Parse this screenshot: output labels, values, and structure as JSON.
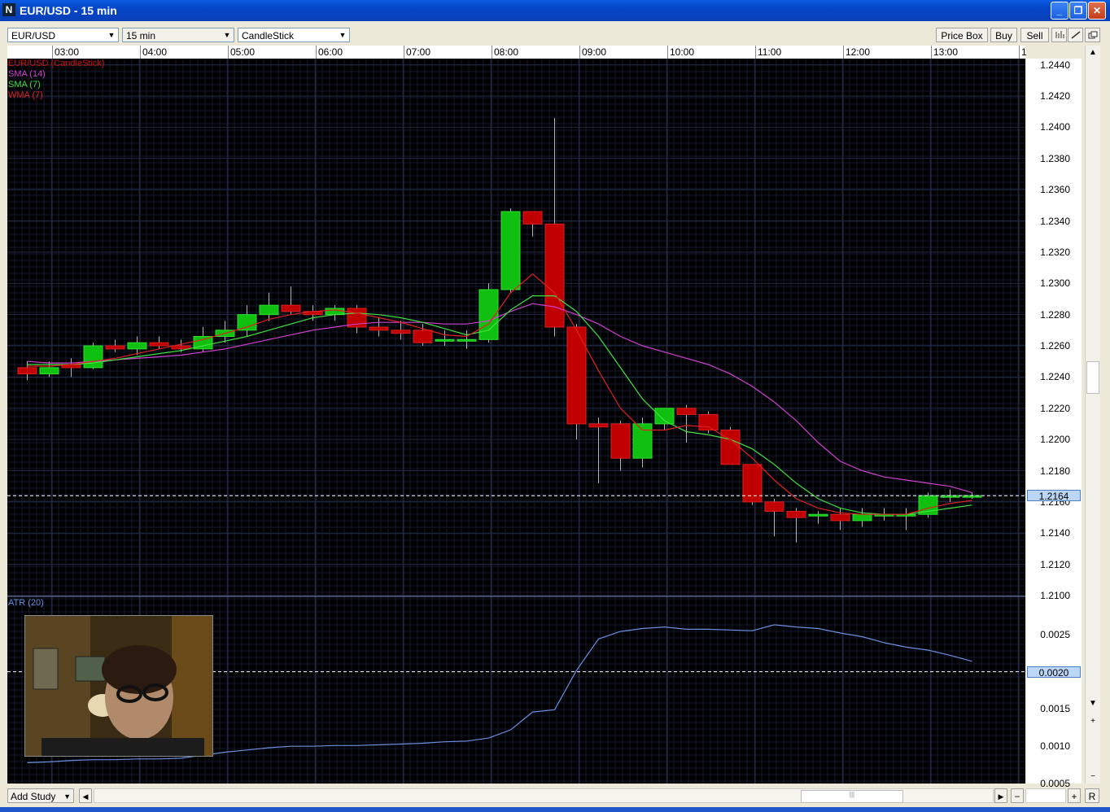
{
  "window": {
    "title": "EUR/USD - 15 min",
    "minimize": "_",
    "restore": "❐",
    "close": "✕"
  },
  "toolbar": {
    "symbol": "EUR/USD",
    "interval": "15 min",
    "chart_style": "CandleStick",
    "price_box_label": "Price Box",
    "buy_label": "Buy",
    "sell_label": "Sell",
    "draw_icon_1": "bar-chart-icon",
    "draw_icon_2": "line-draw-icon",
    "detach_icon": "detach-window-icon"
  },
  "legend": [
    {
      "label": "EUR/USD (CandleStick)",
      "color": "#cc1010"
    },
    {
      "label": "SMA (14)",
      "color": "#d040d0"
    },
    {
      "label": "SMA (7)",
      "color": "#40e040"
    },
    {
      "label": "WMA (7)",
      "color": "#e02020"
    }
  ],
  "atr_label": "ATR (20)",
  "current_price_label": "1.2164",
  "atr_current_label": "0.0020",
  "bottom": {
    "add_study": "Add Study",
    "zoom_out": "−",
    "zoom_in": "+",
    "reset": "R",
    "thumb_grip": "|||"
  },
  "chart_data": [
    {
      "type": "candlestick",
      "symbol": "EUR/USD",
      "time_ticks": [
        "03:00",
        "04:00",
        "05:00",
        "06:00",
        "07:00",
        "08:00",
        "09:00",
        "10:00",
        "11:00",
        "12:00",
        "13:00",
        "1"
      ],
      "y_ticks": [
        "1.2440",
        "1.2420",
        "1.2400",
        "1.2380",
        "1.2360",
        "1.2340",
        "1.2320",
        "1.2300",
        "1.2280",
        "1.2260",
        "1.2240",
        "1.2220",
        "1.2200",
        "1.2180",
        "1.2160",
        "1.2140",
        "1.2120",
        "1.2100"
      ],
      "ylim": [
        1.21,
        1.2444
      ],
      "candles": [
        {
          "o": 1.2246,
          "h": 1.225,
          "l": 1.2238,
          "c": 1.2242
        },
        {
          "o": 1.2242,
          "h": 1.225,
          "l": 1.224,
          "c": 1.2246
        },
        {
          "o": 1.2248,
          "h": 1.2252,
          "l": 1.224,
          "c": 1.2246
        },
        {
          "o": 1.2246,
          "h": 1.2262,
          "l": 1.2245,
          "c": 1.226
        },
        {
          "o": 1.226,
          "h": 1.2264,
          "l": 1.2256,
          "c": 1.2258
        },
        {
          "o": 1.2258,
          "h": 1.2266,
          "l": 1.2254,
          "c": 1.2262
        },
        {
          "o": 1.2262,
          "h": 1.2266,
          "l": 1.2258,
          "c": 1.226
        },
        {
          "o": 1.226,
          "h": 1.2264,
          "l": 1.2256,
          "c": 1.2258
        },
        {
          "o": 1.2258,
          "h": 1.2272,
          "l": 1.2256,
          "c": 1.2266
        },
        {
          "o": 1.2266,
          "h": 1.2276,
          "l": 1.2262,
          "c": 1.227
        },
        {
          "o": 1.227,
          "h": 1.2286,
          "l": 1.2266,
          "c": 1.228
        },
        {
          "o": 1.228,
          "h": 1.2294,
          "l": 1.2276,
          "c": 1.2286
        },
        {
          "o": 1.2286,
          "h": 1.2298,
          "l": 1.228,
          "c": 1.2282
        },
        {
          "o": 1.2282,
          "h": 1.2286,
          "l": 1.2276,
          "c": 1.228
        },
        {
          "o": 1.228,
          "h": 1.2286,
          "l": 1.2276,
          "c": 1.2284
        },
        {
          "o": 1.2284,
          "h": 1.2286,
          "l": 1.2268,
          "c": 1.2272
        },
        {
          "o": 1.2272,
          "h": 1.2278,
          "l": 1.2266,
          "c": 1.227
        },
        {
          "o": 1.227,
          "h": 1.2276,
          "l": 1.2264,
          "c": 1.2268
        },
        {
          "o": 1.227,
          "h": 1.2274,
          "l": 1.226,
          "c": 1.2262
        },
        {
          "o": 1.2263,
          "h": 1.227,
          "l": 1.226,
          "c": 1.2264
        },
        {
          "o": 1.2264,
          "h": 1.227,
          "l": 1.2258,
          "c": 1.2264
        },
        {
          "o": 1.2264,
          "h": 1.23,
          "l": 1.2262,
          "c": 1.2296
        },
        {
          "o": 1.2296,
          "h": 1.2348,
          "l": 1.2294,
          "c": 1.2346
        },
        {
          "o": 1.2346,
          "h": 1.2346,
          "l": 1.233,
          "c": 1.2338
        },
        {
          "o": 1.2338,
          "h": 1.2406,
          "l": 1.2266,
          "c": 1.2272
        },
        {
          "o": 1.2272,
          "h": 1.2274,
          "l": 1.22,
          "c": 1.221
        },
        {
          "o": 1.221,
          "h": 1.2214,
          "l": 1.2172,
          "c": 1.2208
        },
        {
          "o": 1.221,
          "h": 1.2212,
          "l": 1.218,
          "c": 1.2188
        },
        {
          "o": 1.2188,
          "h": 1.2214,
          "l": 1.2182,
          "c": 1.221
        },
        {
          "o": 1.221,
          "h": 1.222,
          "l": 1.2206,
          "c": 1.222
        },
        {
          "o": 1.222,
          "h": 1.2222,
          "l": 1.2198,
          "c": 1.2216
        },
        {
          "o": 1.2216,
          "h": 1.2218,
          "l": 1.2204,
          "c": 1.2206
        },
        {
          "o": 1.2206,
          "h": 1.2208,
          "l": 1.2184,
          "c": 1.2184
        },
        {
          "o": 1.2184,
          "h": 1.2184,
          "l": 1.2158,
          "c": 1.216
        },
        {
          "o": 1.216,
          "h": 1.2162,
          "l": 1.2138,
          "c": 1.2154
        },
        {
          "o": 1.2154,
          "h": 1.2156,
          "l": 1.2134,
          "c": 1.215
        },
        {
          "o": 1.2152,
          "h": 1.2154,
          "l": 1.2146,
          "c": 1.2152
        },
        {
          "o": 1.2152,
          "h": 1.2156,
          "l": 1.2142,
          "c": 1.2148
        },
        {
          "o": 1.2148,
          "h": 1.2156,
          "l": 1.2144,
          "c": 1.2152
        },
        {
          "o": 1.2152,
          "h": 1.2156,
          "l": 1.2148,
          "c": 1.2152
        },
        {
          "o": 1.2152,
          "h": 1.2156,
          "l": 1.2142,
          "c": 1.2152
        },
        {
          "o": 1.2152,
          "h": 1.2166,
          "l": 1.215,
          "c": 1.2164
        },
        {
          "o": 1.2164,
          "h": 1.2168,
          "l": 1.216,
          "c": 1.2164
        },
        {
          "o": 1.2164,
          "h": 1.2166,
          "l": 1.2162,
          "c": 1.2164
        }
      ],
      "sma14": [
        1.225,
        1.2249,
        1.2249,
        1.225,
        1.2251,
        1.2252,
        1.2253,
        1.2254,
        1.2256,
        1.2258,
        1.2261,
        1.2264,
        1.2267,
        1.227,
        1.2272,
        1.2274,
        1.2275,
        1.2275,
        1.2275,
        1.2274,
        1.2274,
        1.2276,
        1.2282,
        1.2287,
        1.2285,
        1.228,
        1.2274,
        1.2266,
        1.226,
        1.2256,
        1.2252,
        1.2248,
        1.2242,
        1.2234,
        1.2224,
        1.2212,
        1.2198,
        1.2186,
        1.218,
        1.2176,
        1.2174,
        1.2172,
        1.217,
        1.2166
      ],
      "sma7": [
        1.2248,
        1.2248,
        1.2248,
        1.2249,
        1.2251,
        1.2253,
        1.2255,
        1.2257,
        1.226,
        1.2263,
        1.2266,
        1.227,
        1.2274,
        1.2278,
        1.228,
        1.2281,
        1.228,
        1.2278,
        1.2275,
        1.2271,
        1.2267,
        1.227,
        1.2283,
        1.2292,
        1.2292,
        1.2282,
        1.2266,
        1.2246,
        1.2226,
        1.2212,
        1.2205,
        1.2203,
        1.22,
        1.2194,
        1.2184,
        1.2172,
        1.2162,
        1.2156,
        1.2153,
        1.2152,
        1.2152,
        1.2154,
        1.2156,
        1.2158
      ],
      "wma7": [
        1.2247,
        1.2247,
        1.2248,
        1.225,
        1.2252,
        1.2255,
        1.2258,
        1.2261,
        1.2264,
        1.2268,
        1.2272,
        1.2277,
        1.228,
        1.2282,
        1.2283,
        1.2281,
        1.2278,
        1.2275,
        1.2271,
        1.2267,
        1.2266,
        1.2274,
        1.2294,
        1.2306,
        1.2294,
        1.227,
        1.2244,
        1.222,
        1.2206,
        1.2206,
        1.2209,
        1.2208,
        1.22,
        1.2188,
        1.2174,
        1.2162,
        1.2156,
        1.2153,
        1.2152,
        1.2152,
        1.2152,
        1.2156,
        1.2159,
        1.2161
      ],
      "current_price": 1.2164
    },
    {
      "type": "line",
      "name": "ATR (20)",
      "y_ticks": [
        "0.0025",
        "0.0020",
        "0.0015",
        "0.0010",
        "0.0005"
      ],
      "ylim": [
        0.0005,
        0.003
      ],
      "values": [
        0.00078,
        0.00079,
        0.00081,
        0.00082,
        0.00082,
        0.00083,
        0.00083,
        0.00084,
        0.00088,
        0.00092,
        0.00095,
        0.00098,
        0.001,
        0.001,
        0.00101,
        0.00101,
        0.00102,
        0.00103,
        0.00104,
        0.00106,
        0.00107,
        0.00111,
        0.00122,
        0.00146,
        0.00149,
        0.00202,
        0.00244,
        0.00254,
        0.00258,
        0.0026,
        0.00257,
        0.00257,
        0.00256,
        0.00255,
        0.00263,
        0.0026,
        0.00258,
        0.00252,
        0.00247,
        0.00239,
        0.00233,
        0.00229,
        0.00222,
        0.00214
      ]
    }
  ]
}
